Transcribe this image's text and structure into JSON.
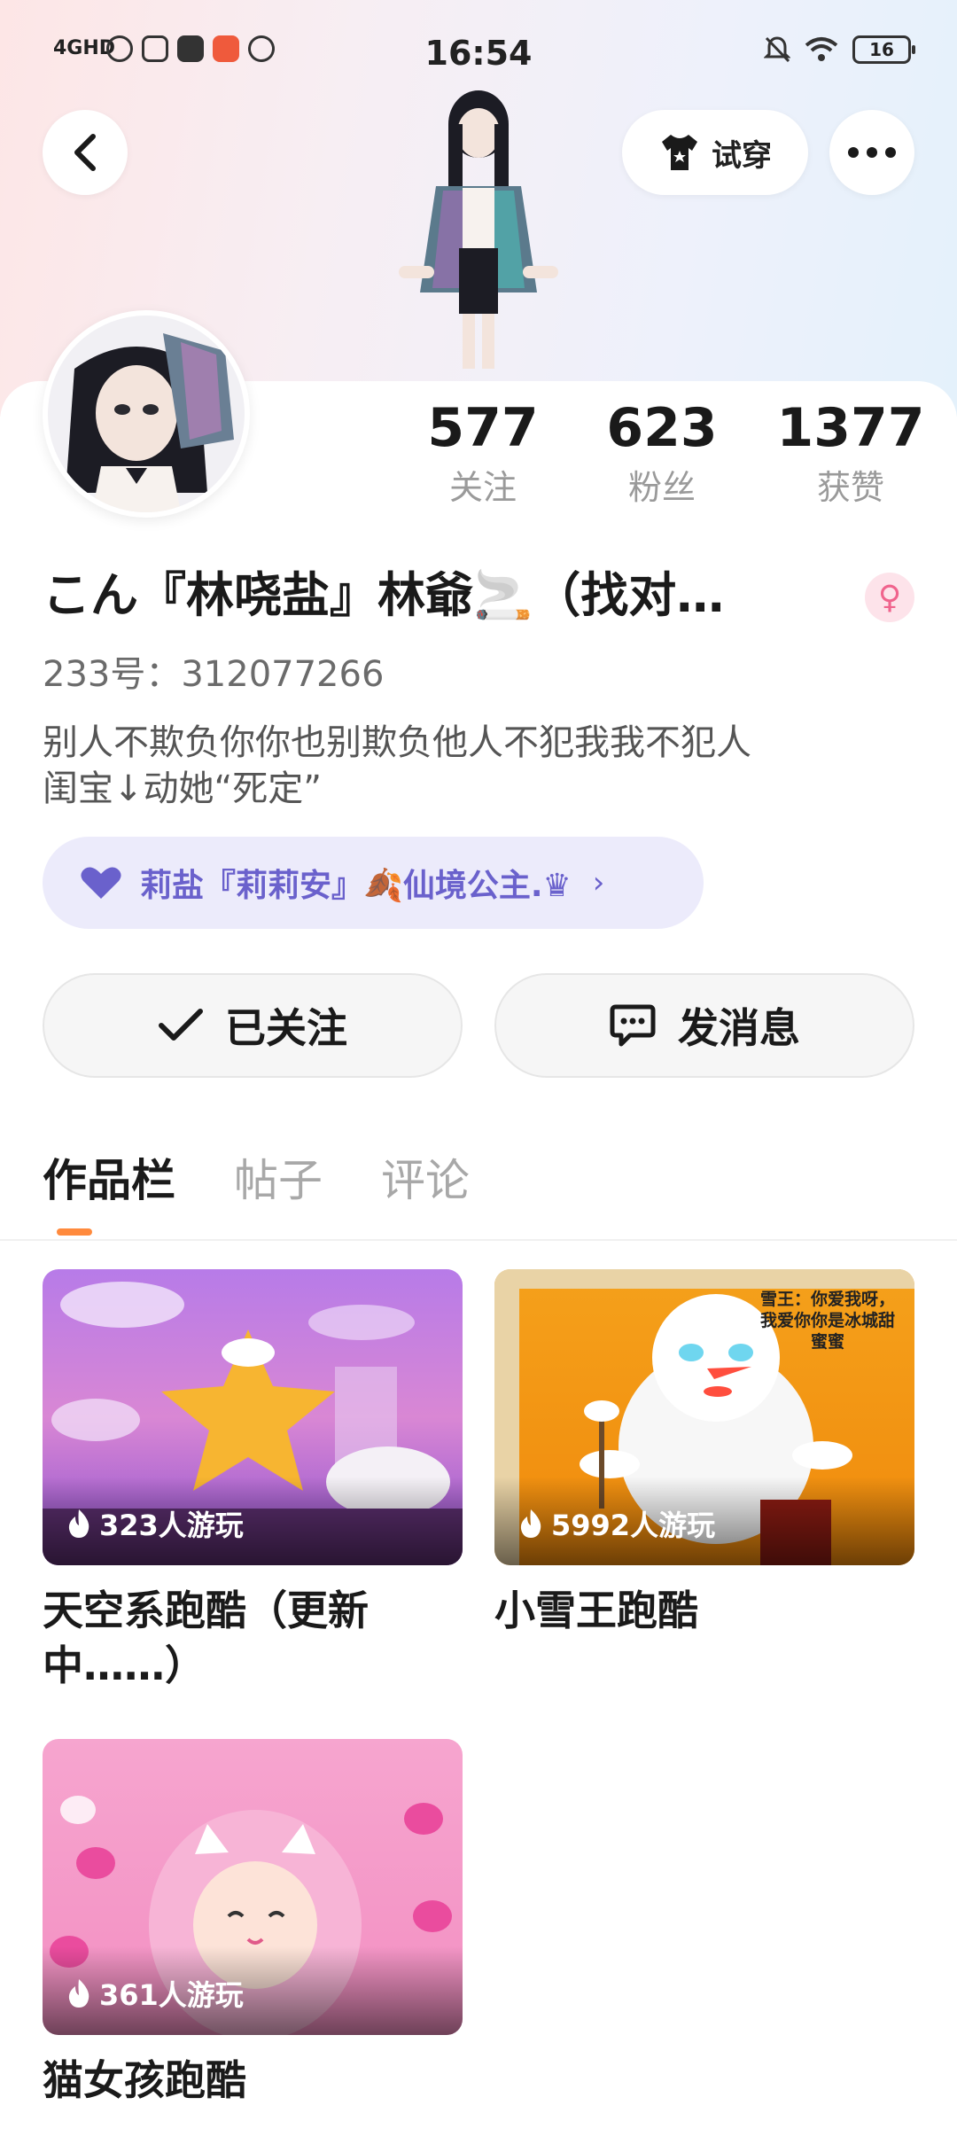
{
  "status_bar": {
    "network": "4GHD",
    "time": "16:54",
    "battery": "16"
  },
  "header": {
    "back_icon": "chevron-left-icon",
    "tryon_label": "试穿",
    "more_icon": "more-dots-icon"
  },
  "stats": [
    {
      "value": "577",
      "label": "关注"
    },
    {
      "value": "623",
      "label": "粉丝"
    },
    {
      "value": "1377",
      "label": "获赞"
    }
  ],
  "profile": {
    "username": "こん『林哓盐』林爺🚬（找对…",
    "gender_symbol": "♀",
    "user_id": "233号：312077266",
    "bio_line1": "别人不欺负你你也别欺负他人不犯我我不犯人",
    "bio_line2": "闺宝↓动她“死定”",
    "couple_text": "莉盐『莉莉安』🍂仙境公主.♛"
  },
  "actions": {
    "followed_label": "已关注",
    "message_label": "发消息"
  },
  "tabs": [
    {
      "label": "作品栏",
      "active": true
    },
    {
      "label": "帖子",
      "active": false
    },
    {
      "label": "评论",
      "active": false
    }
  ],
  "works": [
    {
      "title": "天空系跑酷（更新中……）",
      "plays": "323人游玩",
      "theme": "sky"
    },
    {
      "title": "小雪王跑酷",
      "plays": "5992人游玩",
      "theme": "snow",
      "caption": "雪王：你爱我呀，我爱你你是冰城甜蜜蜜"
    },
    {
      "title": "猫女孩跑酷",
      "plays": "361人游玩",
      "theme": "cat"
    }
  ],
  "colors": {
    "accent_orange": "#ff8a3d",
    "couple_purple": "#6a61cc",
    "gender_pink": "#f0648d"
  }
}
